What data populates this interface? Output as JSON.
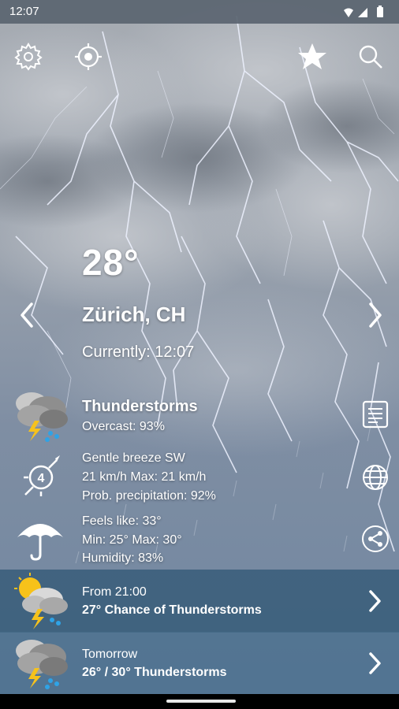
{
  "status_bar": {
    "time": "12:07"
  },
  "current": {
    "temperature": "28°",
    "location": "Zürich, CH",
    "currently": "Currently: 12:07",
    "condition": "Thunderstorms",
    "overcast": "Overcast: 93%",
    "wind": "Gentle breeze SW",
    "wind_beaufort": "4",
    "wind_speed": "21 km/h Max: 21 km/h",
    "precipitation": "Prob. precipitation: 92%",
    "feels_like": "Feels like: 33°",
    "min_max": "Min: 25° Max: 30°",
    "humidity": "Humidity: 83%"
  },
  "forecast": [
    {
      "label": "From 21:00",
      "summary": "27° Chance of Thunderstorms",
      "icon": "sun-cloud-thunder-icon"
    },
    {
      "label": "Tomorrow",
      "summary": "26° / 30° Thunderstorms",
      "icon": "cloud-thunder-icon"
    }
  ],
  "icons": {
    "top": [
      "gear-icon",
      "locate-icon",
      "star-icon",
      "search-icon"
    ],
    "side": [
      "report-icon",
      "globe-icon",
      "share-icon"
    ]
  },
  "colors": {
    "forecast_row_1": "#325876",
    "forecast_row_2": "#466e8c",
    "lightning": "#dfe6ff"
  }
}
